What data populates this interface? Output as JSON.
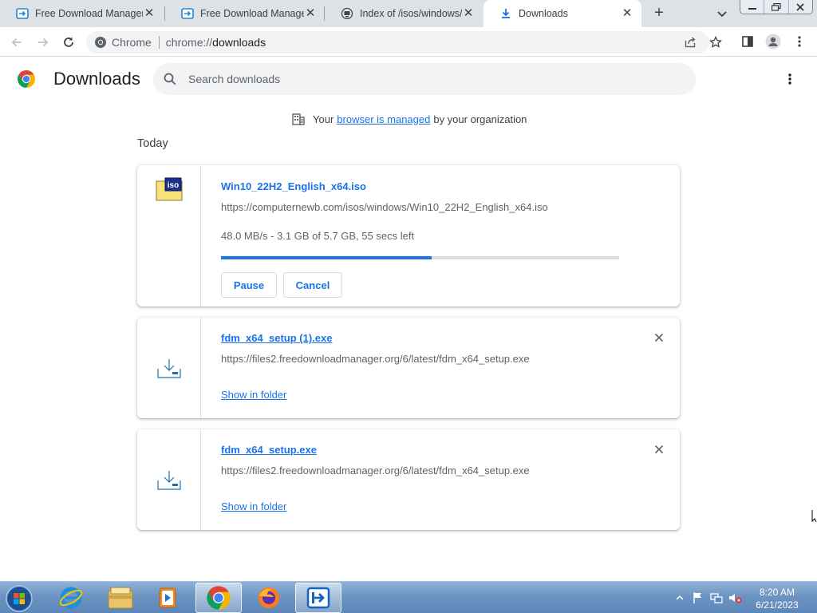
{
  "tabs": [
    {
      "title": "Free Download Manager",
      "active": false,
      "icon": "fdm-icon"
    },
    {
      "title": "Free Download Manager",
      "active": false,
      "icon": "fdm-icon"
    },
    {
      "title": "Index of /isos/windows/",
      "active": false,
      "icon": "computernewb-icon"
    },
    {
      "title": "Downloads",
      "active": true,
      "icon": "download-icon"
    }
  ],
  "toolbar": {
    "site_chip": "Chrome",
    "url_scheme": "chrome://",
    "url_host": "downloads"
  },
  "page": {
    "title": "Downloads",
    "search_placeholder": "Search downloads",
    "managed_prefix": "Your",
    "managed_link": "browser is managed",
    "managed_suffix": "by your organization",
    "date_header": "Today"
  },
  "downloads": [
    {
      "filename": "Win10_22H2_English_x64.iso",
      "url": "https://computernewb.com/isos/windows/Win10_22H2_English_x64.iso",
      "status": "48.0 MB/s - 3.1 GB of 5.7 GB, 55 secs left",
      "progress": 0.53,
      "pause_label": "Pause",
      "cancel_label": "Cancel",
      "icon_text": "iso"
    },
    {
      "filename": "fdm_x64_setup (1).exe",
      "url": "https://files2.freedownloadmanager.org/6/latest/fdm_x64_setup.exe",
      "action": "Show in folder"
    },
    {
      "filename": "fdm_x64_setup.exe",
      "url": "https://files2.freedownloadmanager.org/6/latest/fdm_x64_setup.exe",
      "action": "Show in folder"
    }
  ],
  "taskbar": {
    "apps": [
      "internet-explorer-icon",
      "file-explorer-icon",
      "media-player-icon",
      "chrome-icon",
      "firefox-icon",
      "fdm-icon"
    ],
    "active_app": "chrome-icon",
    "time": "8:20 AM",
    "date": "6/21/2023"
  },
  "colors": {
    "accent": "#1a73e8",
    "tabstrip": "#dee1e6",
    "omnibox": "#f1f3f4",
    "taskbar": "#6d94c2"
  }
}
